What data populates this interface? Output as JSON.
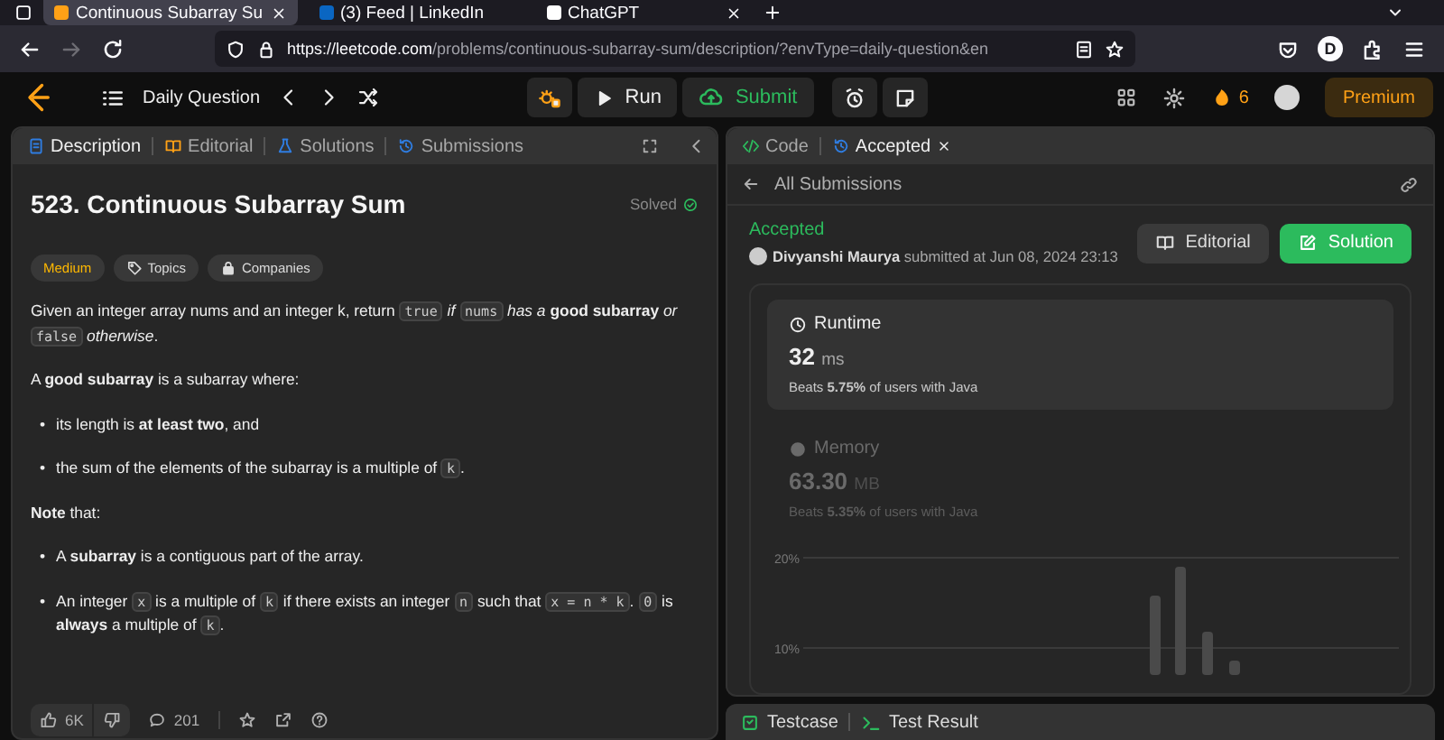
{
  "browser": {
    "tabs": [
      {
        "title": "Continuous Subarray Su",
        "selected": true,
        "closable": true,
        "kind": "leetcode"
      },
      {
        "title": "(3) Feed | LinkedIn",
        "selected": false,
        "closable": false,
        "kind": "linkedin"
      },
      {
        "title": "ChatGPT",
        "selected": false,
        "closable": true,
        "kind": "chatgpt"
      }
    ],
    "url_domain": "https://leetcode.com",
    "url_path": "/problems/continuous-subarray-sum/description/?envType=daily-question&en",
    "profile_initial": "D"
  },
  "header": {
    "daily": "Daily Question",
    "run": "Run",
    "submit": "Submit",
    "streak": "6",
    "premium": "Premium"
  },
  "description": {
    "tabs": [
      {
        "label": "Description",
        "selected": true,
        "kind": "description"
      },
      {
        "label": "Editorial",
        "selected": false,
        "kind": "editorial"
      },
      {
        "label": "Solutions",
        "selected": false,
        "kind": "solutions"
      },
      {
        "label": "Submissions",
        "selected": false,
        "kind": "submissions"
      }
    ],
    "title": "523. Continuous Subarray Sum",
    "status": "Solved",
    "tags": [
      {
        "label": "Medium",
        "kind": "difficulty"
      },
      {
        "label": "Topics",
        "kind": "topics"
      },
      {
        "label": "Companies",
        "kind": "companies"
      }
    ],
    "blocks": [
      {
        "kind": "paragraph",
        "segments": [
          {
            "kind": "text",
            "text": "Given an integer array nums and an integer k, return "
          },
          {
            "kind": "code",
            "text": "true"
          },
          {
            "kind": "text",
            "text": " *if* "
          },
          {
            "kind": "code",
            "text": "nums"
          },
          {
            "kind": "text",
            "text": " *has a* **good subarray** *or* "
          },
          {
            "kind": "code",
            "text": "false"
          },
          {
            "kind": "text",
            "text": " *otherwise*."
          }
        ]
      },
      {
        "kind": "paragraph",
        "segments": [
          {
            "kind": "text",
            "text": "A **good subarray** is a subarray where:"
          }
        ]
      },
      {
        "kind": "list",
        "items": [
          {
            "bullet": "•",
            "segments": [
              {
                "kind": "text",
                "text": "its length is **at least two**, and"
              }
            ]
          },
          {
            "bullet": "•",
            "segments": [
              {
                "kind": "text",
                "text": "the sum of the elements of the subarray is a multiple of "
              },
              {
                "kind": "code",
                "text": "k"
              },
              {
                "kind": "text",
                "text": "."
              }
            ]
          }
        ]
      },
      {
        "kind": "paragraph",
        "segments": [
          {
            "kind": "text",
            "text": "**Note** that:"
          }
        ]
      },
      {
        "kind": "list",
        "items": [
          {
            "bullet": "•",
            "segments": [
              {
                "kind": "text",
                "text": "A **subarray** is a contiguous part of the array."
              }
            ]
          },
          {
            "bullet": "•",
            "segments": [
              {
                "kind": "text",
                "text": "An integer "
              },
              {
                "kind": "code",
                "text": "x"
              },
              {
                "kind": "text",
                "text": " is a multiple of "
              },
              {
                "kind": "code",
                "text": "k"
              },
              {
                "kind": "text",
                "text": " if there exists an integer "
              },
              {
                "kind": "code",
                "text": "n"
              },
              {
                "kind": "text",
                "text": " such that "
              },
              {
                "kind": "code",
                "text": "x = n * k"
              },
              {
                "kind": "text",
                "text": ". "
              },
              {
                "kind": "code",
                "text": "0"
              },
              {
                "kind": "text",
                "text": " is **always** a multiple of "
              },
              {
                "kind": "code",
                "text": "k"
              },
              {
                "kind": "text",
                "text": "."
              }
            ]
          }
        ]
      }
    ],
    "likes": "6K",
    "comments": "201"
  },
  "submission": {
    "tabs": [
      {
        "label": "Code",
        "selected": false,
        "kind": "code"
      },
      {
        "label": "Accepted",
        "selected": true,
        "closable": true,
        "kind": "accepted"
      }
    ],
    "back": "All Submissions",
    "status": "Accepted",
    "author": "Divyanshi Maurya",
    "submitted": "submitted at Jun 08, 2024 23:13",
    "buttons": [
      {
        "label": "Editorial",
        "kind": "secondary"
      },
      {
        "label": "Solution",
        "kind": "primary"
      }
    ],
    "metrics": [
      {
        "title": "Runtime",
        "value": "32",
        "unit": "ms",
        "beats": "Beats **5.75%** of users with Java",
        "selected": true,
        "kind": "clock"
      },
      {
        "title": "Memory",
        "value": "63.30",
        "unit": "MB",
        "beats": "Beats **5.35%** of users with Java",
        "selected": false,
        "kind": "memory"
      }
    ],
    "chart_ticks": [
      "20%",
      "10%"
    ]
  },
  "bottom_tabs": [
    {
      "label": "Testcase",
      "kind": "testcase"
    },
    {
      "label": "Test Result",
      "kind": "result"
    }
  ]
}
